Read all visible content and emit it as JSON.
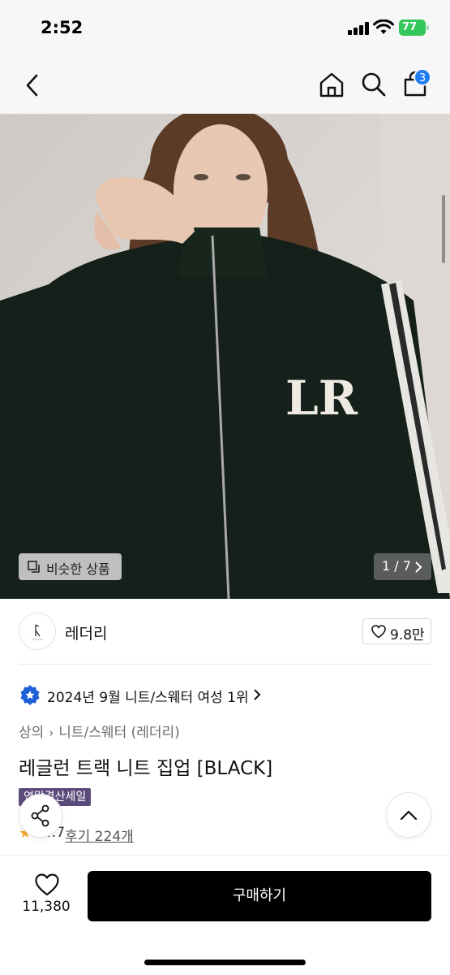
{
  "status_bar": {
    "time": "2:52",
    "battery": "77"
  },
  "header": {
    "cart_count": "3"
  },
  "hero": {
    "similar_label": "비슷한 상품",
    "page_indicator": "1 / 7"
  },
  "brand": {
    "name": "레더리",
    "like_count": "9.8만"
  },
  "ranking": {
    "text": "2024년 9월 니트/스웨터 여성 1위"
  },
  "category": {
    "level1": "상의",
    "level2": "니트/스웨터 (레더리)"
  },
  "product": {
    "title": "레글런 트랙 니트 집업 [BLACK]",
    "sale_badge": "연말결산세일",
    "rating_score": "4.7",
    "review_label": "후기 224개"
  },
  "bottom_bar": {
    "wish_count": "11,380",
    "buy_label": "구매하기"
  },
  "colors": {
    "accent": "#1e7bf0",
    "sale_badge": "#5b4b7a",
    "buy_button": "#000000"
  }
}
